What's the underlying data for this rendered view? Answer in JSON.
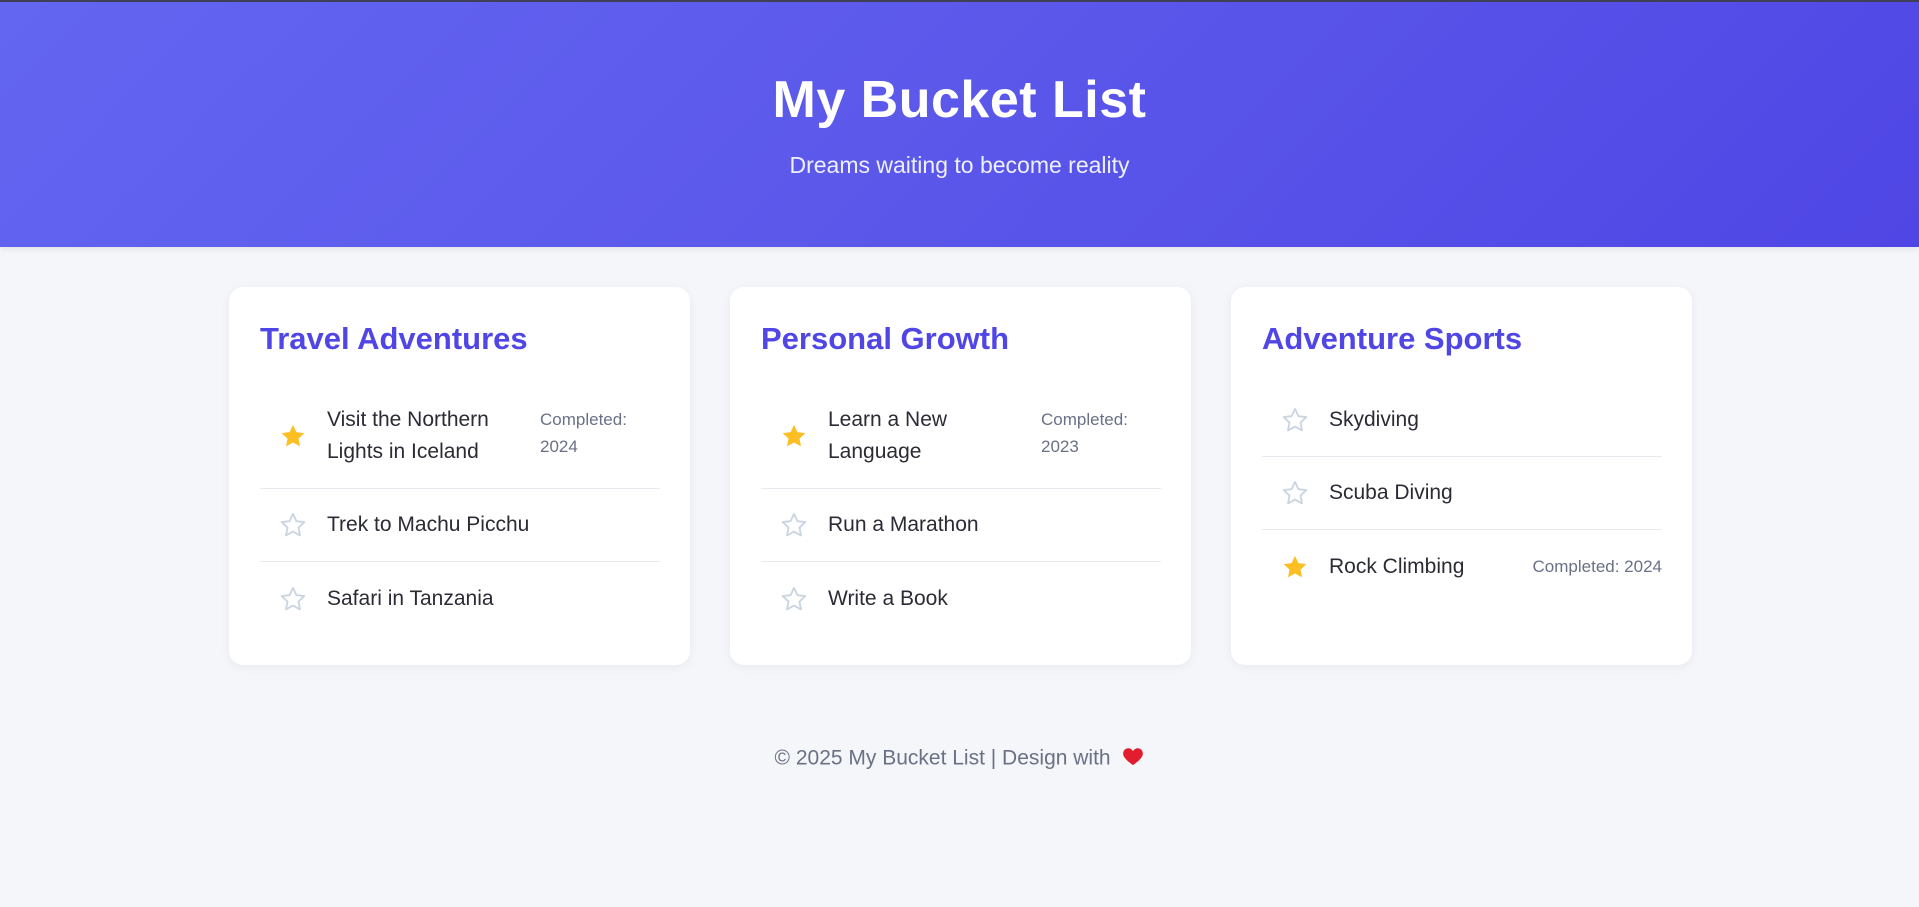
{
  "header": {
    "title": "My Bucket List",
    "subtitle": "Dreams waiting to become reality"
  },
  "categories": [
    {
      "title": "Travel Adventures",
      "items": [
        {
          "title": "Visit the Northern Lights in Iceland",
          "completed": "Completed: 2024",
          "done": true
        },
        {
          "title": "Trek to Machu Picchu",
          "completed": "",
          "done": false
        },
        {
          "title": "Safari in Tanzania",
          "completed": "",
          "done": false
        }
      ]
    },
    {
      "title": "Personal Growth",
      "items": [
        {
          "title": "Learn a New Language",
          "completed": "Completed: 2023",
          "done": true
        },
        {
          "title": "Run a Marathon",
          "completed": "",
          "done": false
        },
        {
          "title": "Write a Book",
          "completed": "",
          "done": false
        }
      ]
    },
    {
      "title": "Adventure Sports",
      "items": [
        {
          "title": "Skydiving",
          "completed": "",
          "done": false
        },
        {
          "title": "Scuba Diving",
          "completed": "",
          "done": false
        },
        {
          "title": "Rock Climbing",
          "completed": "Completed: 2024",
          "done": true
        }
      ]
    }
  ],
  "footer": {
    "text": "© 2025 My Bucket List | Design with",
    "icon": "heart-icon"
  },
  "colors": {
    "accent": "#4f46e5",
    "star_filled": "#fbbf24",
    "star_empty": "#cbd5e1"
  }
}
